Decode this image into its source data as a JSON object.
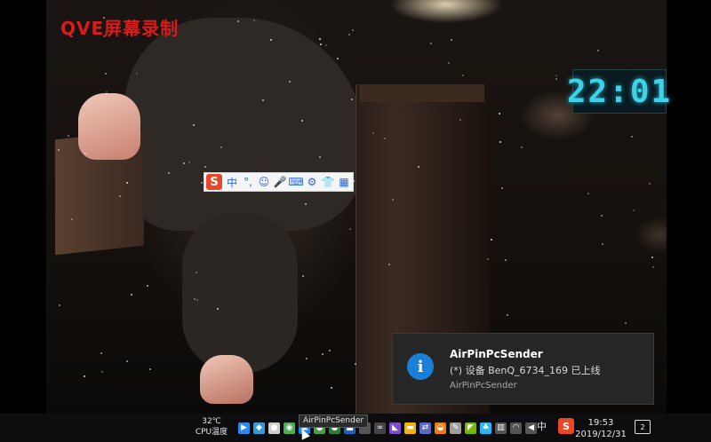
{
  "recorder": {
    "watermark": "QVE屏幕录制"
  },
  "desktop_clock": {
    "time": "22:01"
  },
  "ime_toolbar": {
    "logo": "S",
    "items": [
      "中",
      "°,",
      "☺",
      "🎤",
      "⌨",
      "⚙",
      "👕",
      "▦"
    ]
  },
  "notification": {
    "title": "AirPinPcSender",
    "message": "(*) 设备 BenQ_6734_169 已上线",
    "source": "AirPinPcSender",
    "icon": "info-icon",
    "accent": "#1a7fd6"
  },
  "taskbar": {
    "cpu_temp": "32℃",
    "cpu_label": "CPU温度",
    "tooltip": "AirPinPcSender",
    "language": "中",
    "time": "19:53",
    "date": "2019/12/31",
    "notification_count": "2"
  },
  "tray_icons": [
    {
      "name": "media-player-icon",
      "color": "#2d89ef",
      "glyph": "▶"
    },
    {
      "name": "box-icon",
      "color": "#3a9ad9",
      "glyph": "◆"
    },
    {
      "name": "microphone-icon",
      "color": "#cfcfcf",
      "glyph": "●"
    },
    {
      "name": "airpin-icon",
      "color": "#4caf50",
      "glyph": "◉"
    },
    {
      "name": "app-blue-icon",
      "color": "#1e88e5",
      "glyph": "▣"
    },
    {
      "name": "app-green-icon",
      "color": "#43a047",
      "glyph": "●"
    },
    {
      "name": "app-green2-icon",
      "color": "#2e7d32",
      "glyph": "●"
    },
    {
      "name": "app-square-icon",
      "color": "#1565c0",
      "glyph": "■"
    },
    {
      "name": "chevron-icon",
      "color": "#555555",
      "glyph": "⌃"
    },
    {
      "name": "link-icon",
      "color": "#444444",
      "glyph": "∞"
    },
    {
      "name": "visual-studio-icon",
      "color": "#7b4fc9",
      "glyph": "◣"
    },
    {
      "name": "folder-icon",
      "color": "#f4b400",
      "glyph": "▬"
    },
    {
      "name": "share-icon",
      "color": "#5c6bc0",
      "glyph": "⇄"
    },
    {
      "name": "shield-icon",
      "color": "#f57c00",
      "glyph": "◒"
    },
    {
      "name": "pen-icon",
      "color": "#9e9e9e",
      "glyph": "✎"
    },
    {
      "name": "nvidia-icon",
      "color": "#76b900",
      "glyph": "◤"
    },
    {
      "name": "people-icon",
      "color": "#29b6f6",
      "glyph": "♣"
    },
    {
      "name": "network-icon",
      "color": "#555555",
      "glyph": "▥"
    },
    {
      "name": "wifi-icon",
      "color": "#555555",
      "glyph": "◠"
    },
    {
      "name": "volume-icon",
      "color": "#555555",
      "glyph": "◀"
    }
  ]
}
